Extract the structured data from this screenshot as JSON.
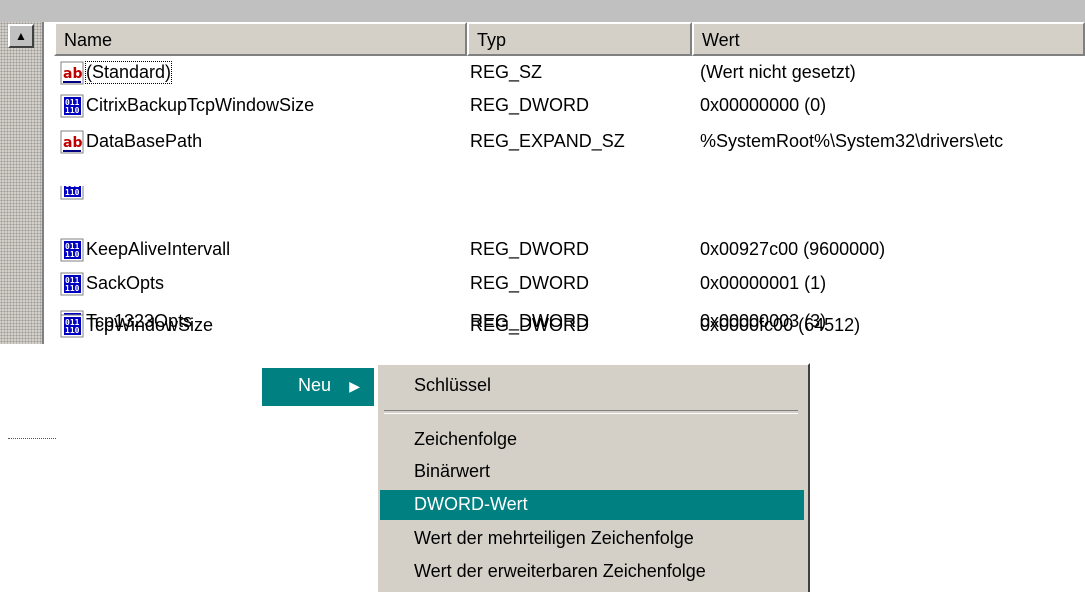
{
  "columns": {
    "name": "Name",
    "type": "Typ",
    "value": "Wert"
  },
  "rows": [
    {
      "icon": "string-value-icon",
      "name": "(Standard)",
      "type": "REG_SZ",
      "value": "(Wert nicht gesetzt)"
    },
    {
      "icon": "binary-value-icon",
      "name": "CitrixBackupTcpWindowSize",
      "type": "REG_DWORD",
      "value": "0x00000000 (0)"
    },
    {
      "icon": "string-value-icon",
      "name": "DataBasePath",
      "type": "REG_EXPAND_SZ",
      "value": "%SystemRoot%\\System32\\drivers\\etc"
    },
    {
      "icon": "binary-value-icon",
      "name": "KeepAliveIntervall",
      "type": "REG_DWORD",
      "value": "0x00927c00 (9600000)"
    },
    {
      "icon": "binary-value-icon",
      "name": "SackOpts",
      "type": "REG_DWORD",
      "value": "0x00000001 (1)"
    },
    {
      "icon": "binary-value-icon",
      "name": "Tcp1323Opts",
      "type": "REG_DWORD",
      "value": "0x00000003 (3)"
    },
    {
      "icon": "binary-value-icon",
      "name": "TcpWindowSize",
      "type": "REG_DWORD",
      "value": "0x0000fc00 (64512)"
    }
  ],
  "context_menu": {
    "new_label": "Neu",
    "submenu": {
      "key": "Schlüssel",
      "string": "Zeichenfolge",
      "binary": "Binärwert",
      "dword": "DWORD-Wert",
      "multi_string": "Wert der mehrteiligen Zeichenfolge",
      "expandable_string": "Wert der erweiterbaren Zeichenfolge"
    },
    "selected": "dword"
  },
  "colors": {
    "highlight": "#008080",
    "menu_bg": "#d4d0c8"
  }
}
